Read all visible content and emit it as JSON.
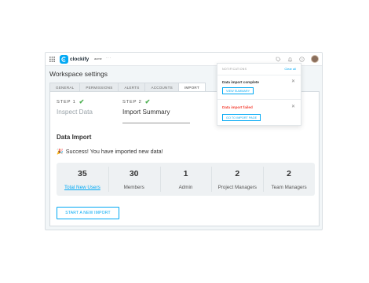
{
  "topbar": {
    "app_name": "clockify",
    "workspace": "acme",
    "more": "···"
  },
  "page_title": "Workspace settings",
  "tabs": [
    "GENERAL",
    "PERMISSIONS",
    "ALERTS",
    "ACCOUNTS",
    "IMPORT"
  ],
  "active_tab": "IMPORT",
  "steps": [
    {
      "label": "STEP 1",
      "title": "Inspect Data",
      "completed": true
    },
    {
      "label": "STEP 2",
      "title": "Import Summary",
      "completed": true
    }
  ],
  "section_title": "Data Import",
  "success_message": "Success! You have imported new data!",
  "stats": [
    {
      "value": "35",
      "label": "Total New Users"
    },
    {
      "value": "30",
      "label": "Members"
    },
    {
      "value": "1",
      "label": "Admin"
    },
    {
      "value": "2",
      "label": "Project Managers"
    },
    {
      "value": "2",
      "label": "Team Managers"
    }
  ],
  "start_button": "START A NEW IMPORT",
  "notifications": {
    "header": "NOTIFICATIONS",
    "clear_all": "Clear all",
    "items": [
      {
        "title": "Data import complete",
        "status": "success",
        "action": "VIEW SUMMARY"
      },
      {
        "title": "Data import failed",
        "status": "error",
        "action": "GO TO IMPORT PAGE"
      }
    ]
  },
  "colors": {
    "accent": "#03a9f4",
    "success": "#4caf50",
    "error": "#f44336"
  }
}
